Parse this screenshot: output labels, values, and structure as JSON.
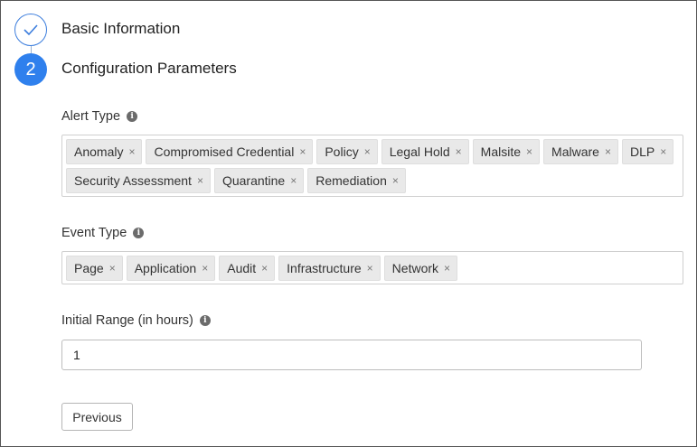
{
  "steps": [
    {
      "label": "Basic Information",
      "status": "complete"
    },
    {
      "number": "2",
      "label": "Configuration Parameters",
      "status": "active"
    }
  ],
  "alert_type": {
    "label": "Alert Type",
    "tags_row1": [
      "Anomaly",
      "Compromised Credential",
      "Policy",
      "Legal Hold",
      "Malsite",
      "Malware",
      "DLP"
    ],
    "tags_row2": [
      "Security Assessment",
      "Quarantine",
      "Remediation"
    ]
  },
  "event_type": {
    "label": "Event Type",
    "tags": [
      "Page",
      "Application",
      "Audit",
      "Infrastructure",
      "Network"
    ]
  },
  "initial_range": {
    "label": "Initial Range (in hours)",
    "value": "1"
  },
  "buttons": {
    "previous": "Previous"
  },
  "icons": {
    "tag_remove": "×",
    "info": "i"
  },
  "colors": {
    "accent": "#2f80ed"
  }
}
